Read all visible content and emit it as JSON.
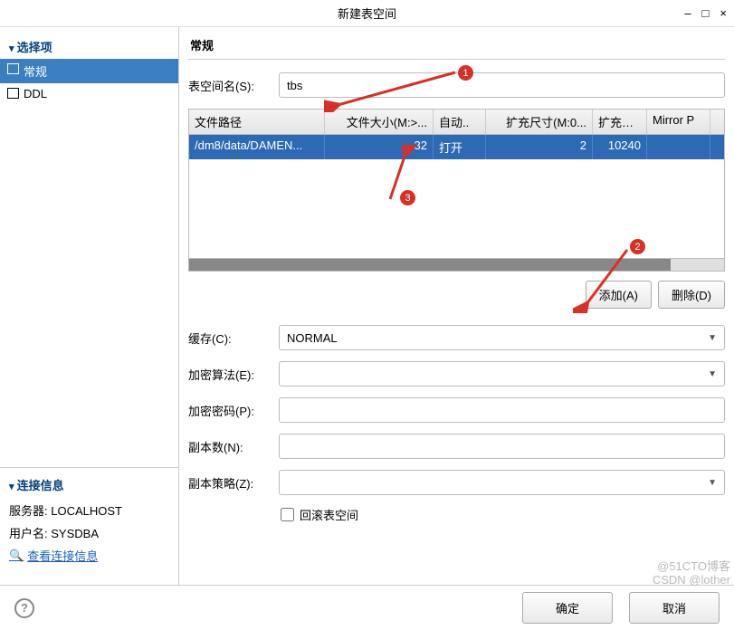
{
  "window": {
    "title": "新建表空间",
    "min": "–",
    "max": "□",
    "close": "×"
  },
  "sidebar": {
    "header": "选择项",
    "items": [
      {
        "label": "常规"
      },
      {
        "label": "DDL"
      }
    ]
  },
  "connection": {
    "header": "连接信息",
    "server_label": "服务器:",
    "server": "LOCALHOST",
    "user_label": "用户名:",
    "user": "SYSDBA",
    "link": "查看连接信息"
  },
  "main": {
    "title": "常规",
    "name_label": "表空间名(S):",
    "name_value": "tbs",
    "table": {
      "headers": [
        "文件路径",
        "文件大小(M:>...",
        "自动..",
        "扩充尺寸(M:0...",
        "扩充上...",
        "Mirror P"
      ],
      "row": {
        "path": "/dm8/data/DAMEN...",
        "size": "32",
        "auto": "打开",
        "ext_size": "2",
        "ext_limit": "10240",
        "mirror": ""
      }
    },
    "add_btn": "添加(A)",
    "del_btn": "删除(D)",
    "cache_label": "缓存(C):",
    "cache_value": "NORMAL",
    "enc_algo_label": "加密算法(E):",
    "enc_algo_value": "",
    "enc_pwd_label": "加密密码(P):",
    "enc_pwd_value": "",
    "copies_label": "副本数(N):",
    "copies_value": "",
    "policy_label": "副本策略(Z):",
    "policy_value": "",
    "rollback_label": "回滚表空间"
  },
  "footer": {
    "ok": "确定",
    "cancel": "取消",
    "help": "?"
  },
  "badges": {
    "b1": "1",
    "b2": "2",
    "b3": "3"
  },
  "watermark": {
    "l1": "@51CTO博客",
    "l2": "CSDN @lother"
  }
}
